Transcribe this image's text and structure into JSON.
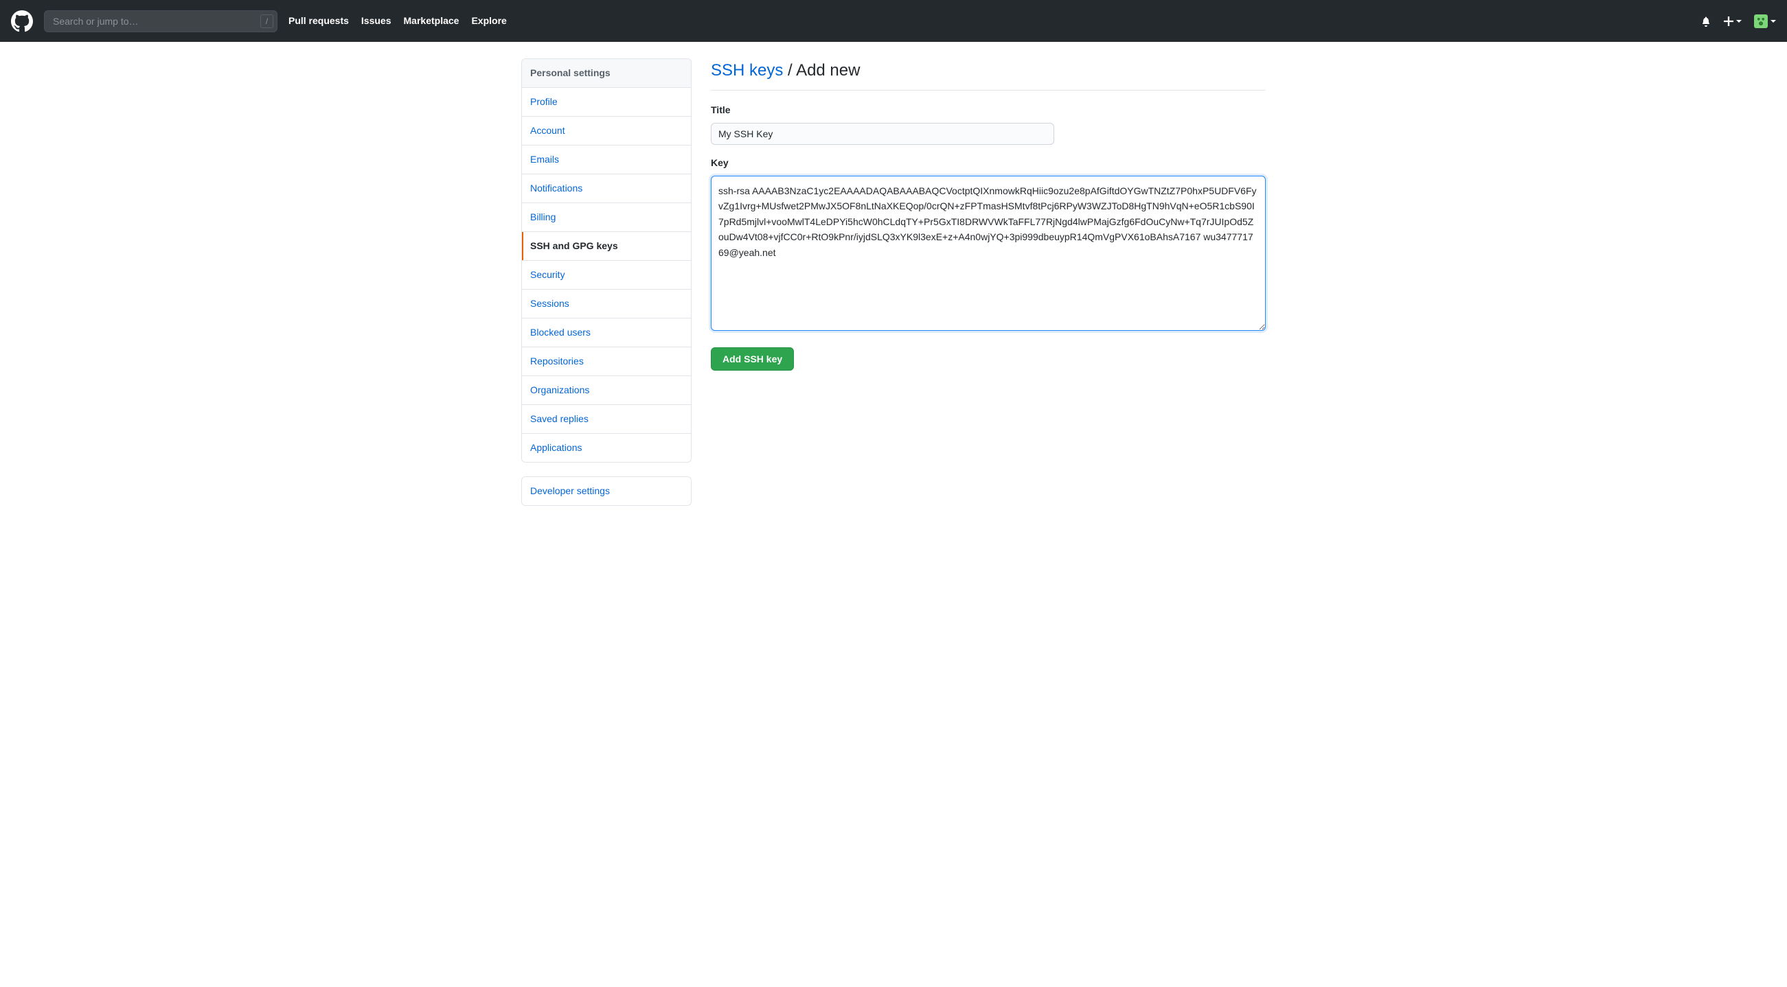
{
  "header": {
    "search_placeholder": "Search or jump to…",
    "slash_key": "/",
    "nav": [
      "Pull requests",
      "Issues",
      "Marketplace",
      "Explore"
    ]
  },
  "sidebar": {
    "heading": "Personal settings",
    "items": [
      {
        "label": "Profile",
        "active": false
      },
      {
        "label": "Account",
        "active": false
      },
      {
        "label": "Emails",
        "active": false
      },
      {
        "label": "Notifications",
        "active": false
      },
      {
        "label": "Billing",
        "active": false
      },
      {
        "label": "SSH and GPG keys",
        "active": true
      },
      {
        "label": "Security",
        "active": false
      },
      {
        "label": "Sessions",
        "active": false
      },
      {
        "label": "Blocked users",
        "active": false
      },
      {
        "label": "Repositories",
        "active": false
      },
      {
        "label": "Organizations",
        "active": false
      },
      {
        "label": "Saved replies",
        "active": false
      },
      {
        "label": "Applications",
        "active": false
      }
    ],
    "developer_link": "Developer settings"
  },
  "page": {
    "breadcrumb_link": "SSH keys",
    "breadcrumb_sep": " / ",
    "breadcrumb_current": "Add new",
    "title_label": "Title",
    "title_value": "My SSH Key",
    "key_label": "Key",
    "key_value": "ssh-rsa AAAAB3NzaC1yc2EAAAADAQABAAABAQCVoctptQIXnmowkRqHiic9ozu2e8pAfGiftdOYGwTNZtZ7P0hxP5UDFV6FyvZg1Ivrg+MUsfwet2PMwJX5OF8nLtNaXKEQop/0crQN+zFPTmasHSMtvf8tPcj6RPyW3WZJToD8HgTN9hVqN+eO5R1cbS90I7pRd5mjlvl+vooMwlT4LeDPYi5hcW0hCLdqTY+Pr5GxTI8DRWVWkTaFFL77RjNgd4lwPMajGzfg6FdOuCyNw+Tq7rJUIpOd5ZouDw4Vt08+vjfCC0r+RtO9kPnr/iyjdSLQ3xYK9l3exE+z+A4n0wjYQ+3pi999dbeuypR14QmVgPVX61oBAhsA7167 wu347771769@yeah.net",
    "submit_label": "Add SSH key"
  }
}
